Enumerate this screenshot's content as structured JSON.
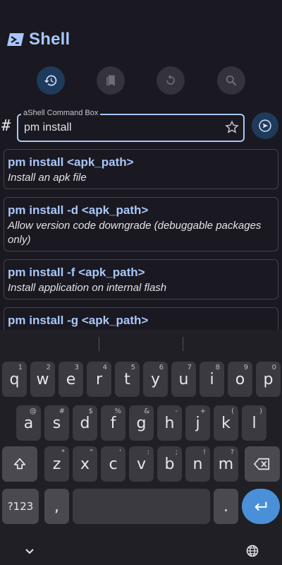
{
  "app": {
    "title": "Shell"
  },
  "toolbar": {
    "buttons": [
      "history-icon",
      "bookmarks-icon",
      "refresh-icon",
      "search-icon"
    ]
  },
  "command": {
    "label": "aShell Command Box",
    "value": "pm install",
    "prompt": "#"
  },
  "suggestions": [
    {
      "title": "pm install <apk_path>",
      "desc": "Install an apk file"
    },
    {
      "title": "pm install -d <apk_path>",
      "desc": "Allow version code downgrade (debuggable packages only)"
    },
    {
      "title": "pm install -f <apk_path>",
      "desc": "Install application on internal flash"
    },
    {
      "title": "pm install -g <apk_path>",
      "desc": ""
    }
  ],
  "keyboard": {
    "row1": [
      [
        "q",
        "1"
      ],
      [
        "w",
        "2"
      ],
      [
        "e",
        "3"
      ],
      [
        "r",
        "4"
      ],
      [
        "t",
        "5"
      ],
      [
        "y",
        "6"
      ],
      [
        "u",
        "7"
      ],
      [
        "i",
        "8"
      ],
      [
        "o",
        "9"
      ],
      [
        "p",
        "0"
      ]
    ],
    "row2": [
      [
        "a",
        "@"
      ],
      [
        "s",
        "#"
      ],
      [
        "d",
        "$"
      ],
      [
        "f",
        "%"
      ],
      [
        "g",
        "&"
      ],
      [
        "h",
        "-"
      ],
      [
        "j",
        "+"
      ],
      [
        "k",
        "("
      ],
      [
        "l",
        ")"
      ]
    ],
    "row3": [
      [
        "z",
        "*"
      ],
      [
        "x",
        "\""
      ],
      [
        "c",
        "'"
      ],
      [
        "v",
        ":"
      ],
      [
        "b",
        ";"
      ],
      [
        "n",
        "!"
      ],
      [
        "m",
        "?"
      ]
    ],
    "symbols_label": "?123",
    "comma": ",",
    "period": "."
  },
  "colors": {
    "accent": "#a8c7fa",
    "enter": "#4a90d9",
    "background": "#1a1820"
  }
}
